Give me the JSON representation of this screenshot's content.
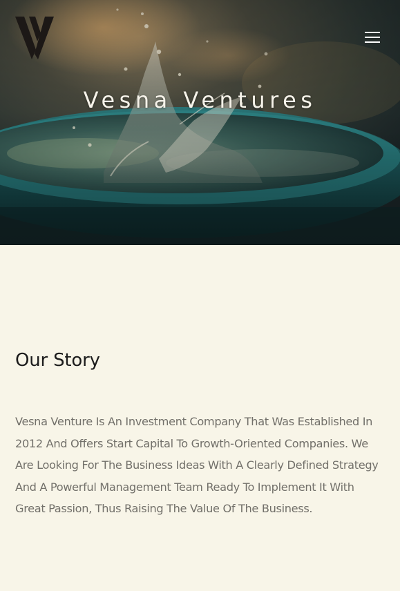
{
  "brand": {
    "logo_icon": "v-logo-icon",
    "title": "Vesna Ventures"
  },
  "header": {
    "menu_icon": "hamburger-menu-icon"
  },
  "hero": {
    "image": "water-splash-photo"
  },
  "story": {
    "heading": "Our Story",
    "body": "Vesna Venture Is An Investment Company That Was Established In 2012 And Offers Start Capital To Growth-Oriented Companies. We Are Looking For The Business Ideas With A Clearly Defined Strategy And A Powerful Management Team Ready To Implement It With Great Passion, Thus Raising The Value Of The Business."
  },
  "colors": {
    "page_background": "#f8f5e8",
    "heading": "#1c1c1c",
    "body_text": "#72706a",
    "hero_title": "#f6f3ea",
    "water_teal": "#1f6b6e"
  }
}
